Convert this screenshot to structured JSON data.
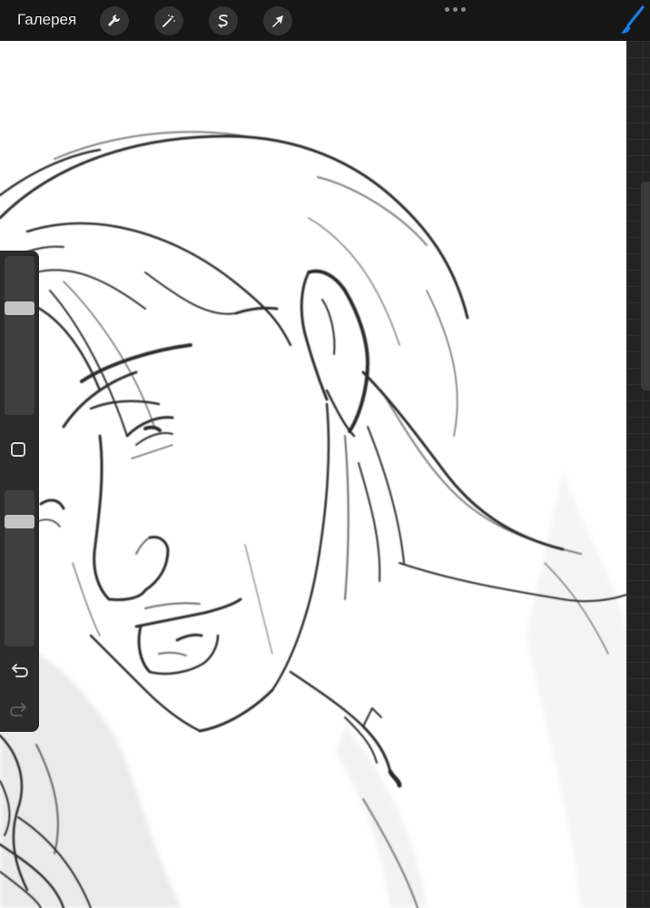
{
  "toolbar": {
    "gallery_label": "Галерея",
    "tools": [
      {
        "name": "adjustments",
        "icon": "wrench-icon"
      },
      {
        "name": "adjustments-magic",
        "icon": "magic-wand-icon"
      },
      {
        "name": "selection",
        "icon": "selection-s-icon"
      },
      {
        "name": "transform",
        "icon": "arrow-cursor-icon"
      }
    ],
    "more_icon": "ellipsis-icon",
    "brush_icon": "brush-icon",
    "brush_color": "#1a7fe0"
  },
  "sidebar": {
    "size_level": 0.31,
    "opacity_level": 0.17,
    "modify_icon": "square-icon",
    "undo_icon": "undo-arrow-icon",
    "redo_icon": "redo-arrow-icon"
  },
  "canvas": {
    "content": "pencil-sketch",
    "background": "#ffffff",
    "stroke_color": "#2a2a2a"
  }
}
